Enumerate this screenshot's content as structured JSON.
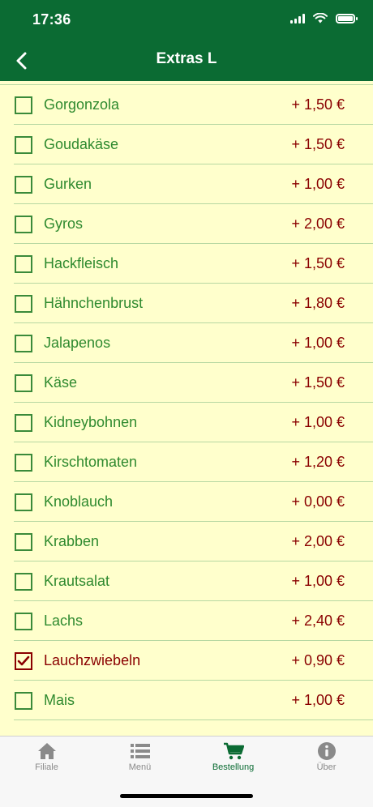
{
  "status_bar": {
    "time": "17:36"
  },
  "nav": {
    "title": "Extras L"
  },
  "colors": {
    "brand": "#0b6b33",
    "background": "#ffffcc",
    "price": "#8a0000",
    "item": "#2f8a2f"
  },
  "items": [
    {
      "label": "Gorgonzola",
      "price": "+ 1,50 €",
      "checked": false
    },
    {
      "label": "Goudakäse",
      "price": "+ 1,50 €",
      "checked": false
    },
    {
      "label": "Gurken",
      "price": "+ 1,00 €",
      "checked": false
    },
    {
      "label": "Gyros",
      "price": "+ 2,00 €",
      "checked": false
    },
    {
      "label": "Hackfleisch",
      "price": "+ 1,50 €",
      "checked": false
    },
    {
      "label": "Hähnchenbrust",
      "price": "+ 1,80 €",
      "checked": false
    },
    {
      "label": "Jalapenos",
      "price": "+ 1,00 €",
      "checked": false
    },
    {
      "label": "Käse",
      "price": "+ 1,50 €",
      "checked": false
    },
    {
      "label": "Kidneybohnen",
      "price": "+ 1,00 €",
      "checked": false
    },
    {
      "label": "Kirschtomaten",
      "price": "+ 1,20 €",
      "checked": false
    },
    {
      "label": "Knoblauch",
      "price": "+ 0,00 €",
      "checked": false
    },
    {
      "label": "Krabben",
      "price": "+ 2,00 €",
      "checked": false
    },
    {
      "label": "Krautsalat",
      "price": "+ 1,00 €",
      "checked": false
    },
    {
      "label": "Lachs",
      "price": "+ 2,40 €",
      "checked": false
    },
    {
      "label": "Lauchzwiebeln",
      "price": "+ 0,90 €",
      "checked": true
    },
    {
      "label": "Mais",
      "price": "+ 1,00 €",
      "checked": false
    }
  ],
  "tabs": [
    {
      "label": "Filiale",
      "icon": "home-icon",
      "active": false
    },
    {
      "label": "Menü",
      "icon": "list-icon",
      "active": false
    },
    {
      "label": "Bestellung",
      "icon": "cart-icon",
      "active": true
    },
    {
      "label": "Über",
      "icon": "info-icon",
      "active": false
    }
  ]
}
